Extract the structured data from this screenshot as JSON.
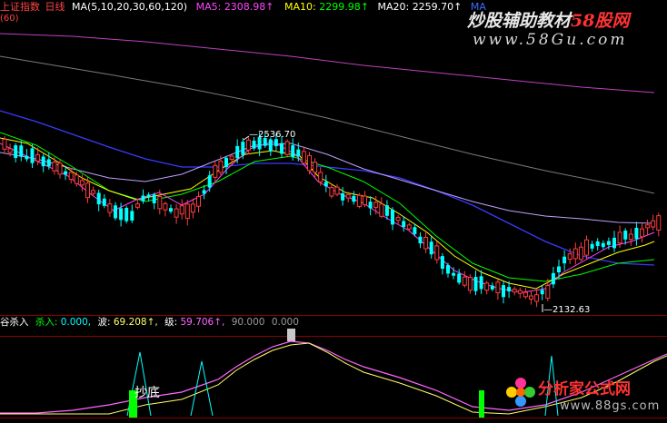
{
  "header": {
    "index_name": "上证指数",
    "period": "日线",
    "ma_params": "MA(5,10,20,30,60,120)",
    "ma5_label": "MA5:",
    "ma5_value": "2308.98↑",
    "ma10_label": "MA10:",
    "ma10_value": "2299.98↑",
    "ma20_label": "MA20:",
    "ma20_value": "2259.70↑",
    "more_label": "MA",
    "left_partial": "(60)"
  },
  "price_chart": {
    "high_label": "—2536.70",
    "low_label": "—2132.63",
    "y_range": [
      2090,
      2680
    ]
  },
  "indicator": {
    "name": "谷杀入",
    "line1_label": "杀入:",
    "line1_value": "0.000,",
    "line2_label": "波:",
    "line2_value": "69.208↑,",
    "line3_label": "级:",
    "line3_value": "59.706↑,",
    "line4_value": "90.000",
    "line5_value": "0.000",
    "signal_text": "抄底"
  },
  "watermarks": {
    "top_title": "炒股辅助教材",
    "top_title_num": "58股网",
    "top_url": "www.58Gu.com",
    "bottom_title": "分析家公式网",
    "bottom_url": "www.88gs.com"
  },
  "colors": {
    "background": "#000000",
    "up": "#ff3c3c",
    "down": "#00ffff",
    "ma5": "#ffffff",
    "ma10": "#ffff00",
    "ma20": "#ff44ff",
    "ma30": "#00ff00",
    "ma60": "#3a3aff",
    "ma120": "#c040c0",
    "grid": "#8b0000"
  }
}
